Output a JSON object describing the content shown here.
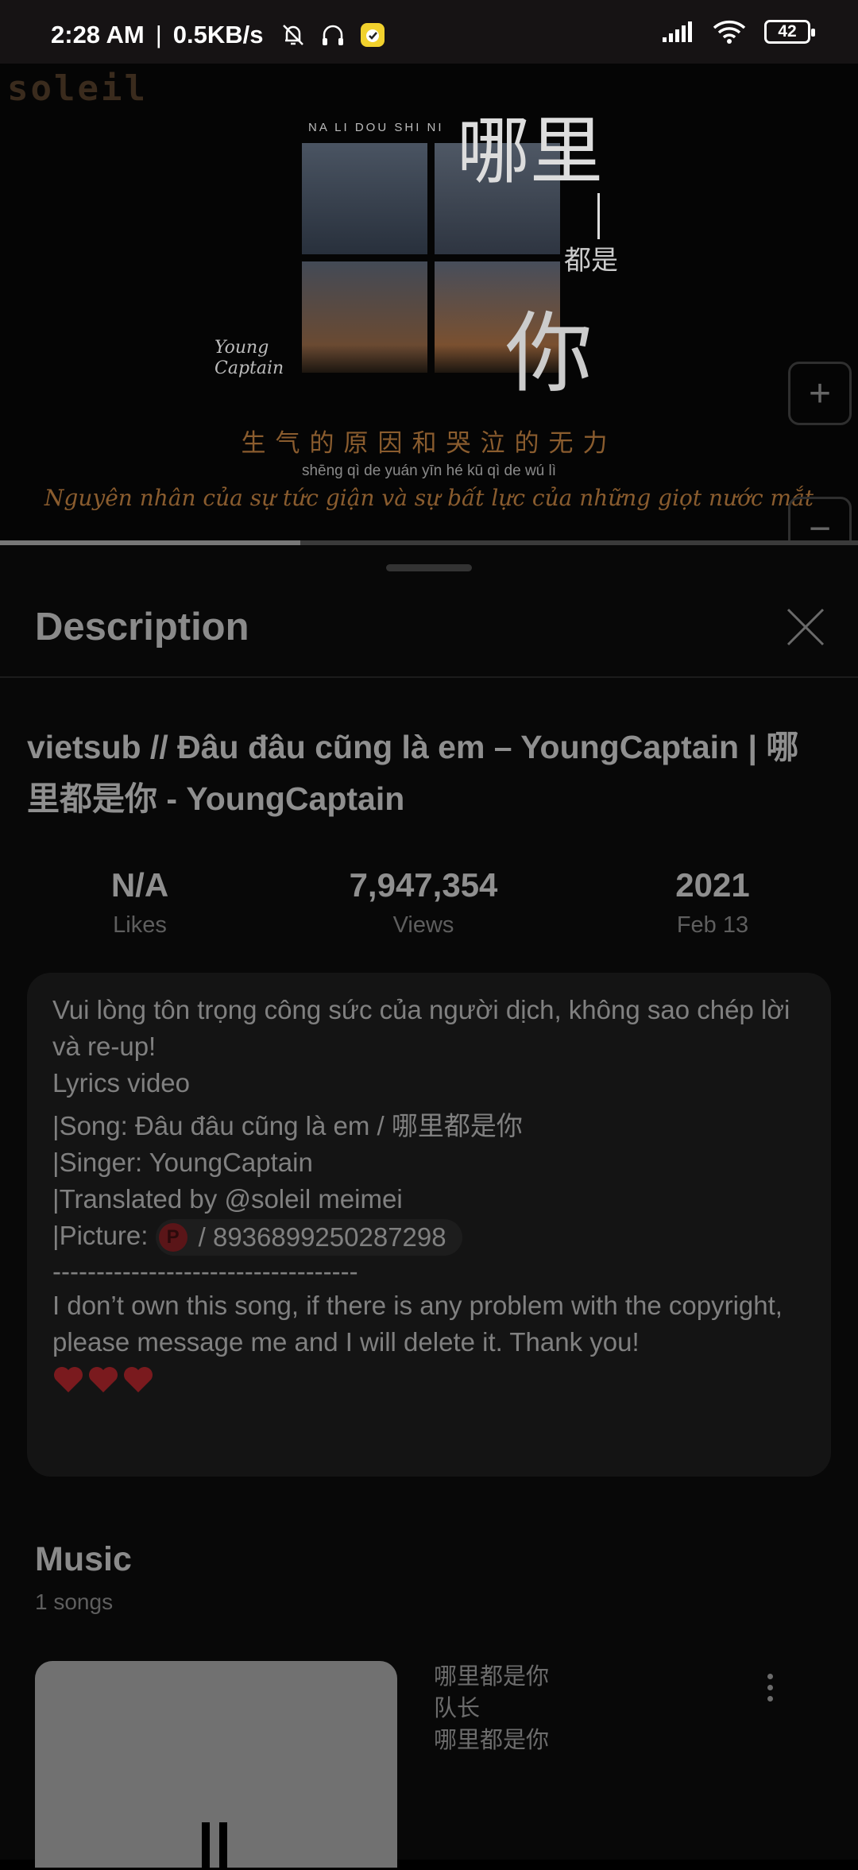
{
  "status_bar": {
    "time": "2:28 AM",
    "separator": "|",
    "network_speed": "0.5KB/s",
    "battery": "42"
  },
  "video": {
    "channel_watermark": "soleil",
    "art_pinyin": "NA LI DOU SHI NI",
    "art_title_top": "哪里",
    "art_title_mid": "都是",
    "art_title_you": "你",
    "art_credit": "Young\nCaptain",
    "lyric_chinese": "生气的原因和哭泣的无力",
    "lyric_pinyin": "shēng qì de yuán yīn hé kū qì de wú lì",
    "lyric_vietnamese": "Nguyên nhân của sự tức giận và sự bất lực của những giọt nước mắt",
    "zoom_in_label": "+",
    "zoom_out_label": "−",
    "progress_fraction": 0.35
  },
  "sheet": {
    "title": "Description",
    "video_title": "vietsub // Đâu đâu cũng là em – YoungCaptain | 哪里都是你  - YoungCaptain",
    "stats": [
      {
        "value": "N/A",
        "label": "Likes"
      },
      {
        "value": "7,947,354",
        "label": "Views"
      },
      {
        "value": "2021",
        "label": "Feb 13"
      }
    ],
    "description": {
      "line1": "Vui lòng tôn trọng công sức của người dịch, không sao chép lời và re-up!",
      "line2": "Lyrics video",
      "line3": "|Song: Đâu đâu cũng là em / 哪里都是你",
      "line4": "|Singer: YoungCaptain",
      "line5": "|Translated by @soleil meimei",
      "picture_prefix": "|Picture:",
      "picture_link": "/ 8936899250287298",
      "dashes": "-----------------------------------",
      "line6": "I don’t own this song, if there is any problem with the copyright, please message me and I will delete it. Thank you!"
    },
    "music": {
      "title": "Music",
      "count": "1 songs",
      "song_title": "哪里都是你",
      "song_artist": "队长",
      "song_album": "哪里都是你"
    }
  },
  "colors": {
    "accent_heart": "#7a1a1e",
    "lyric_accent": "#8a5c2e"
  }
}
